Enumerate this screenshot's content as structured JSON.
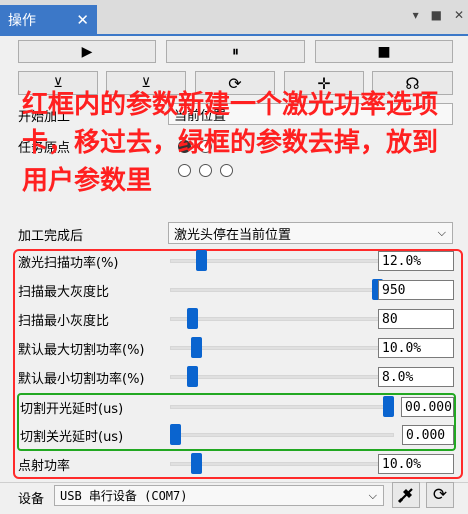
{
  "tab": {
    "title": "操作",
    "close": "✕"
  },
  "window_controls": [
    "▾",
    "■",
    "✕"
  ],
  "toolbar1": {
    "play": "▶",
    "pause": "⏸",
    "stop": "■"
  },
  "toolbar2": {
    "icons": [
      "⊻",
      "⊻",
      "⟳",
      "✛",
      "☊"
    ]
  },
  "row_start": {
    "label": "开始加工",
    "value": "当前位置"
  },
  "row_position": {
    "label": "任务原点"
  },
  "annotation": "红框内的参数新建一个激光功率选项卡，移过去，绿框的参数去掉，放到用户参数里",
  "after_process": {
    "label": "加工完成后",
    "value": "激光头停在当前位置"
  },
  "sliders": [
    {
      "label": "激光扫描功率(%)",
      "value": "12.0%",
      "level": 0.12
    },
    {
      "label": "扫描最大灰度比",
      "value": "950",
      "level": 0.95
    },
    {
      "label": "扫描最小灰度比",
      "value": "80",
      "level": 0.08
    },
    {
      "label": "默认最大切割功率(%)",
      "value": "10.0%",
      "level": 0.1
    },
    {
      "label": "默认最小切割功率(%)",
      "value": "8.0%",
      "level": 0.08
    },
    {
      "label": "切割开光延时(us)",
      "value": "00.000",
      "level": 1.0
    },
    {
      "label": "切割关光延时(us)",
      "value": "0.000",
      "level": 0.0
    },
    {
      "label": "点射功率",
      "value": "10.0%",
      "level": 0.1
    }
  ],
  "device": {
    "label": "设备",
    "value": "USB 串行设备 (COM7)"
  },
  "colors": {
    "accent": "#3c78c8",
    "red": "#ff2a2a",
    "green": "#22a822",
    "thumb": "#0a64cf"
  }
}
